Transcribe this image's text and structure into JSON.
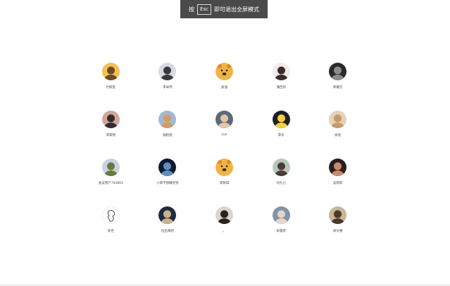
{
  "banner": {
    "prefix": "按",
    "key": "Esc",
    "suffix": "即可退出全屏模式"
  },
  "members": [
    {
      "name": "付婉莹",
      "icon": "avatar-photo-icon",
      "colors": [
        "#f3c24a",
        "#6b4a2a"
      ]
    },
    {
      "name": "李卓然",
      "icon": "avatar-photo-icon",
      "colors": [
        "#d6dbe2",
        "#3a3a3a"
      ]
    },
    {
      "name": "加油",
      "icon": "winnie-the-pooh-icon",
      "colors": [
        "#f2b43c",
        "#e08a22"
      ]
    },
    {
      "name": "潘佳欣",
      "icon": "avatar-photo-icon",
      "colors": [
        "#f4eaea",
        "#3b2c2c"
      ]
    },
    {
      "name": "郭睿哲",
      "icon": "avatar-photo-icon",
      "colors": [
        "#2a2a2a",
        "#8c8c8c"
      ]
    },
    {
      "name": "李家铭",
      "icon": "avatar-photo-icon",
      "colors": [
        "#c9a9a0",
        "#3a2a2a"
      ]
    },
    {
      "name": "陆程程",
      "icon": "avatar-photo-icon",
      "colors": [
        "#9fb9d8",
        "#d99a5a"
      ]
    },
    {
      "name": "Lux",
      "icon": "avatar-photo-icon",
      "colors": [
        "#5a6a7a",
        "#e4c6a6"
      ]
    },
    {
      "name": "李乐",
      "icon": "avatar-photo-icon",
      "colors": [
        "#1e1e2a",
        "#f5d036"
      ]
    },
    {
      "name": "徐浩",
      "icon": "avatar-photo-icon",
      "colors": [
        "#e7d2b8",
        "#c79a6a"
      ]
    },
    {
      "name": "会议用户743803",
      "icon": "avatar-photo-icon",
      "colors": [
        "#c8d3de",
        "#6a7a3a"
      ]
    },
    {
      "name": "小草不想睡觉觉",
      "icon": "avatar-photo-icon",
      "colors": [
        "#0f1a2e",
        "#5f8fbf"
      ]
    },
    {
      "name": "李佩琪",
      "icon": "winnie-the-pooh-icon",
      "colors": [
        "#f2b43c",
        "#e08a22"
      ]
    },
    {
      "name": "司九儿",
      "icon": "avatar-photo-icon",
      "colors": [
        "#b9c7b8",
        "#4a3a3a"
      ]
    },
    {
      "name": "吴雨菲",
      "icon": "avatar-photo-icon",
      "colors": [
        "#2a1f1f",
        "#c98a6a"
      ]
    },
    {
      "name": "宋佳",
      "icon": "avatar-sketch-icon",
      "colors": [
        "#ffffff",
        "#222222"
      ]
    },
    {
      "name": "拉出来吧",
      "icon": "avatar-photo-icon",
      "colors": [
        "#1e2a44",
        "#c9b28a"
      ]
    },
    {
      "name": "。",
      "icon": "avatar-photo-icon",
      "colors": [
        "#d9d4cf",
        "#2a2020"
      ]
    },
    {
      "name": "宋嘉彦",
      "icon": "avatar-photo-icon",
      "colors": [
        "#7f93ab",
        "#e3d6c8"
      ]
    },
    {
      "name": "徐文惠",
      "icon": "avatar-photo-icon",
      "colors": [
        "#c9b59a",
        "#4a3a2a"
      ]
    }
  ]
}
